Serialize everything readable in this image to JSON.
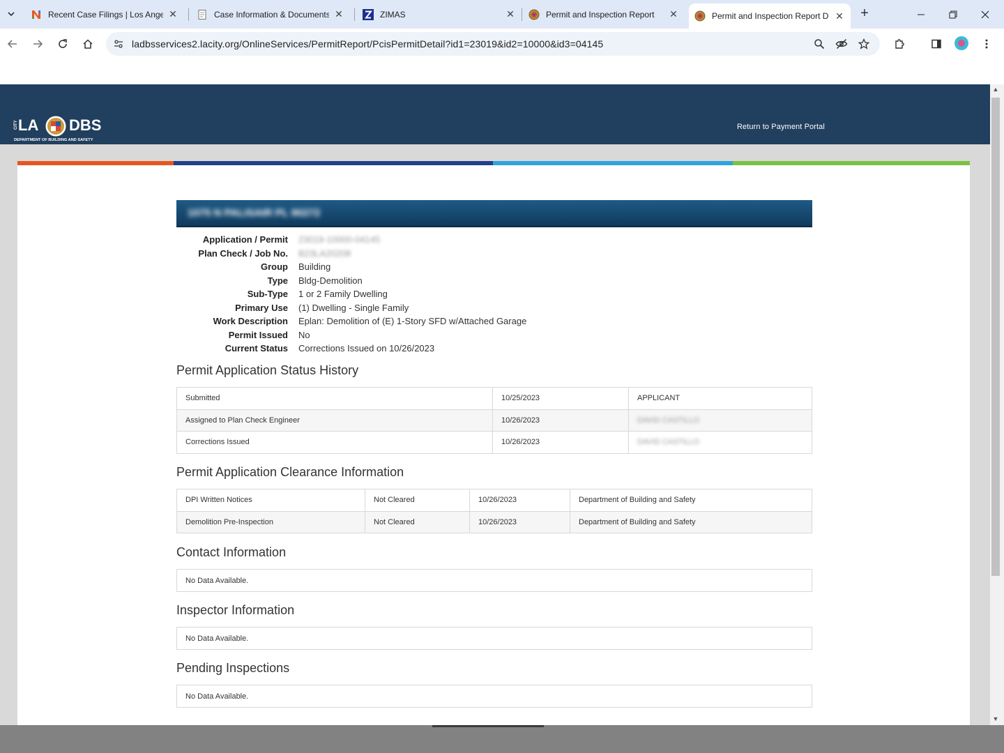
{
  "browser": {
    "tabs": [
      {
        "title": "Recent Case Filings | Los Angeles",
        "icon": "colorful-n-favicon"
      },
      {
        "title": "Case Information & Documents",
        "icon": "document-favicon"
      },
      {
        "title": "ZIMAS",
        "icon": "zimas-z-favicon"
      },
      {
        "title": "Permit and Inspection Report",
        "icon": "city-seal-favicon"
      },
      {
        "title": "Permit and Inspection Report D",
        "icon": "city-seal-favicon",
        "active": true
      }
    ],
    "url": "ladbsservices2.lacity.org/OnlineServices/PermitReport/PcisPermitDetail?id1=23019&id2=10000&id3=04145"
  },
  "site": {
    "logo_text_left": "LA",
    "logo_text_right": "DBS",
    "logo_city": "CITY",
    "logo_tagline": "DEPARTMENT OF BUILDING AND SAFETY",
    "return_link": "Return to Payment Portal",
    "stripe_colors": [
      "#e8561f",
      "#213f8a",
      "#2fa3dc",
      "#7cc243"
    ]
  },
  "permit": {
    "address": "1075 N PALISAIR PL 90272",
    "fields": [
      {
        "label": "Application / Permit",
        "value": "23019-10000-04145",
        "blurred": true
      },
      {
        "label": "Plan Check / Job No.",
        "value": "B23LA20208",
        "blurred": true
      },
      {
        "label": "Group",
        "value": "Building"
      },
      {
        "label": "Type",
        "value": "Bldg-Demolition"
      },
      {
        "label": "Sub-Type",
        "value": "1 or 2 Family Dwelling"
      },
      {
        "label": "Primary Use",
        "value": "(1) Dwelling - Single Family"
      },
      {
        "label": "Work Description",
        "value": "Eplan: Demolition of (E) 1-Story SFD w/Attached Garage"
      },
      {
        "label": "Permit Issued",
        "value": "No"
      },
      {
        "label": "Current Status",
        "value": "Corrections Issued on 10/26/2023"
      }
    ]
  },
  "status_history": {
    "title": "Permit Application Status History",
    "rows": [
      {
        "event": "Submitted",
        "date": "10/25/2023",
        "by": "APPLICANT",
        "blurred": false
      },
      {
        "event": "Assigned to Plan Check Engineer",
        "date": "10/26/2023",
        "by": "DAVID CASTILLO",
        "blurred": true
      },
      {
        "event": "Corrections Issued",
        "date": "10/26/2023",
        "by": "DAVID CASTILLO",
        "blurred": true
      }
    ]
  },
  "clearance": {
    "title": "Permit Application Clearance Information",
    "rows": [
      {
        "item": "DPI Written Notices",
        "status": "Not Cleared",
        "date": "10/26/2023",
        "agency": "Department of Building and Safety"
      },
      {
        "item": "Demolition Pre-Inspection",
        "status": "Not Cleared",
        "date": "10/26/2023",
        "agency": "Department of Building and Safety"
      }
    ]
  },
  "contact": {
    "title": "Contact Information",
    "empty": "No Data Available."
  },
  "inspector": {
    "title": "Inspector Information",
    "empty": "No Data Available."
  },
  "pending": {
    "title": "Pending Inspections",
    "empty": "No Data Available."
  }
}
